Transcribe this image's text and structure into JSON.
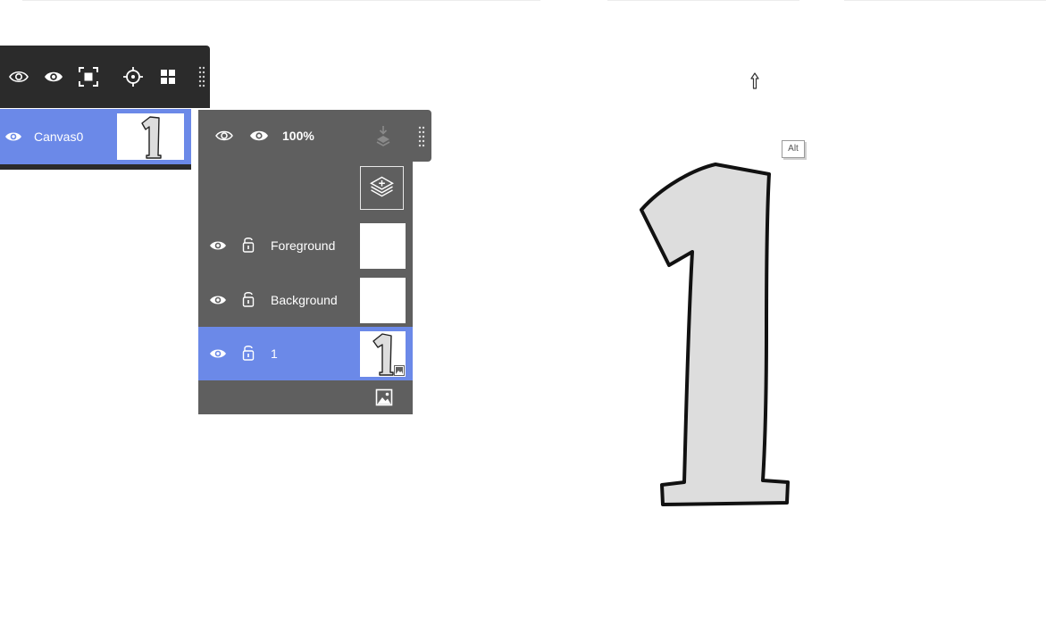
{
  "canvas_toolbar": {
    "icons": [
      "eye-outline-icon",
      "eye-icon",
      "focus-frame-icon",
      "crosshair-icon",
      "grid-icon",
      "drag-handle-icon"
    ]
  },
  "canvas": {
    "name": "Canvas0",
    "thumbnail_glyph": "1"
  },
  "layer_panel": {
    "opacity": "100%",
    "layers": [
      {
        "name": "Foreground",
        "visible": true,
        "locked": false,
        "selected": false
      },
      {
        "name": "Background",
        "visible": true,
        "locked": false,
        "selected": false
      },
      {
        "name": "1",
        "visible": true,
        "locked": false,
        "selected": true
      }
    ],
    "icons": [
      "eye-outline-icon",
      "eye-icon",
      "merge-down-icon",
      "drag-handle-icon",
      "new-layer-icon",
      "add-image-icon"
    ]
  },
  "canvas_area": {
    "modifier_badge": "Alt",
    "drawing_glyph": "1"
  },
  "colors": {
    "toolbar_bg": "#2b2b2b",
    "panel_bg": "#5f5f5f",
    "selection": "#6b89e8",
    "glyph_fill": "#dddddd",
    "glyph_stroke": "#111111"
  }
}
